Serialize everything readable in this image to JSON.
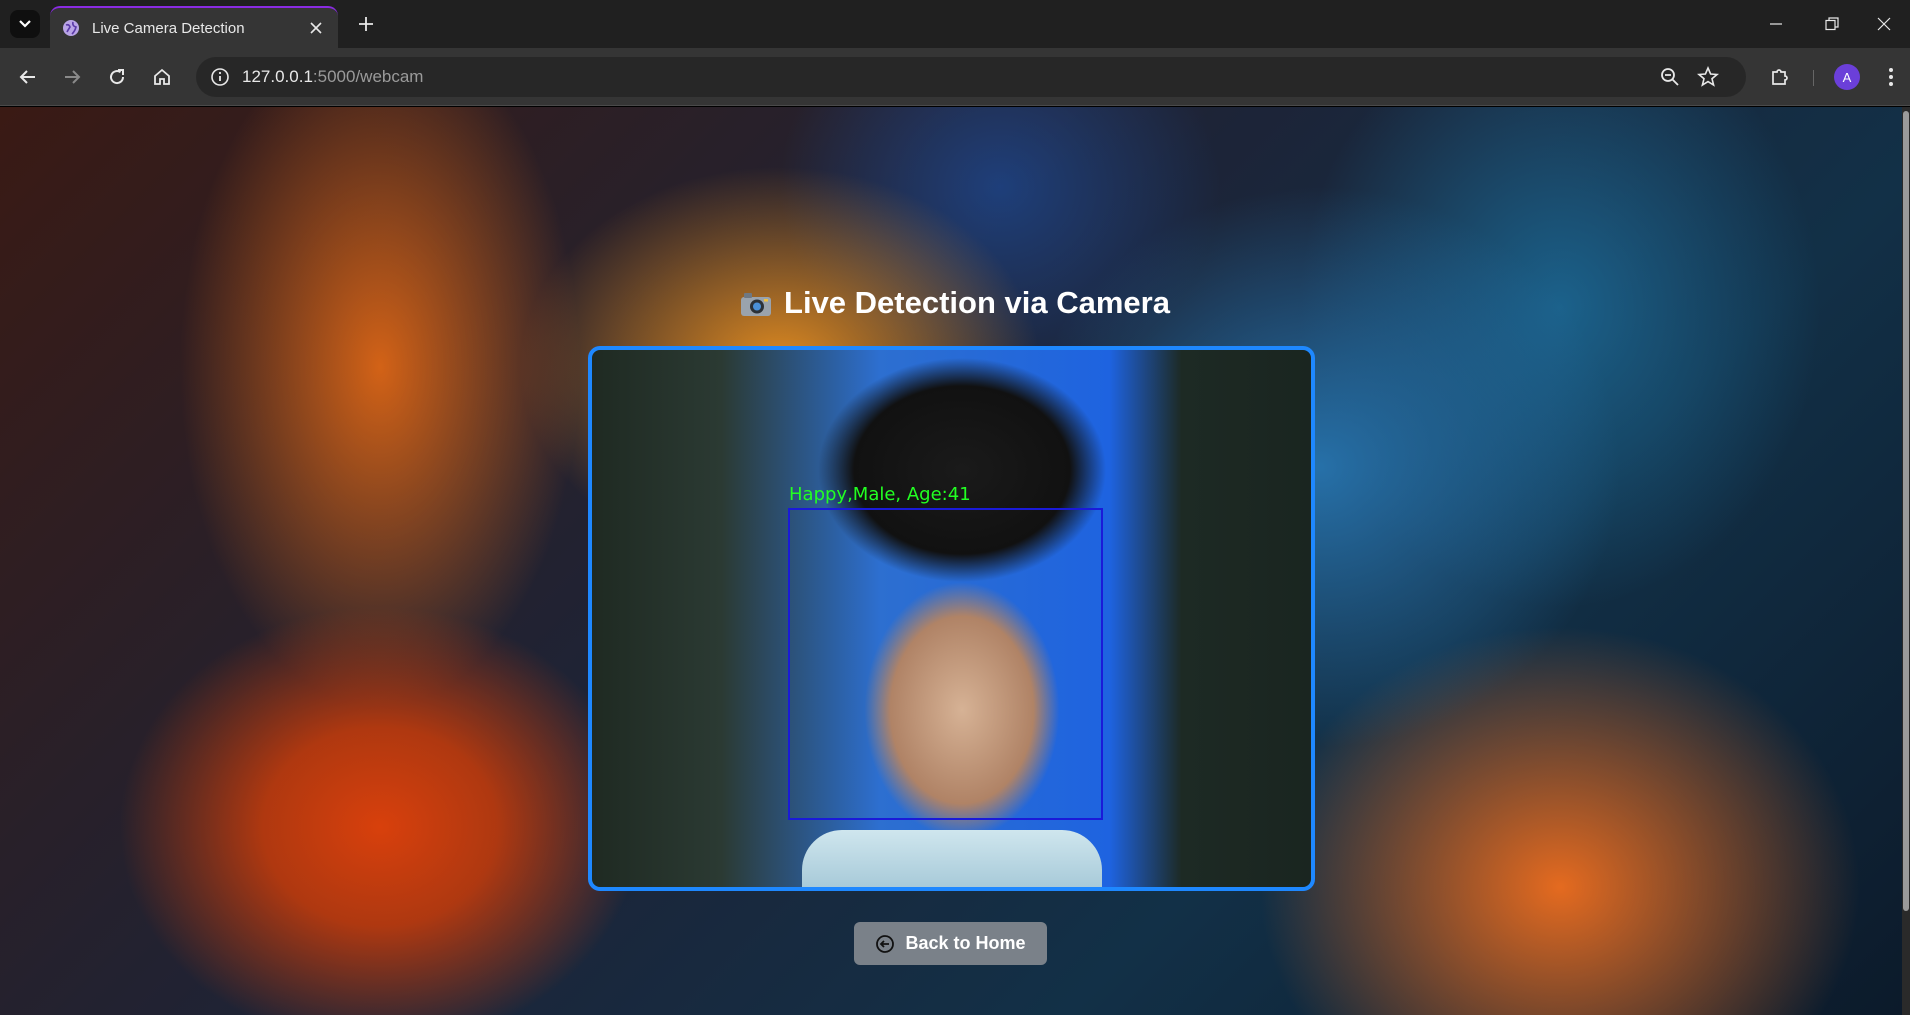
{
  "browser": {
    "tab_title": "Live Camera Detection",
    "url_host": "127.0.0.1",
    "url_rest": ":5000/webcam",
    "profile_initial": "A",
    "accent_color": "#8a2be2"
  },
  "page": {
    "heading": "Live Detection via Camera",
    "heading_icon": "camera-icon",
    "detection_label": "Happy,Male, Age:41",
    "frame_border_color": "#1e88ff",
    "box_color": "#1a1ad8",
    "label_color": "#22ff22",
    "back_button_label": "Back to Home"
  }
}
